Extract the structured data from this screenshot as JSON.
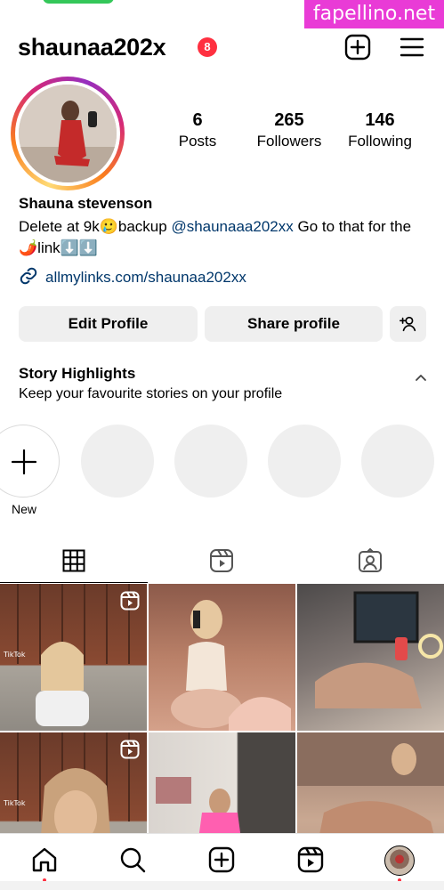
{
  "watermark": "fapellino.net",
  "header": {
    "username": "shaunaa202x",
    "notification_count": "8",
    "icons": [
      "add-post-icon",
      "menu-icon"
    ]
  },
  "profile": {
    "stats": [
      {
        "value": "6",
        "label": "Posts"
      },
      {
        "value": "265",
        "label": "Followers"
      },
      {
        "value": "146",
        "label": "Following"
      }
    ],
    "full_name": "Shauna stevenson",
    "bio": {
      "part1": "Delete at 9k🥲backup ",
      "mention": "@shaunaaa202xx",
      "part2": "      Go to that for the 🌶️link⬇️⬇️"
    },
    "link": "allmylinks.com/shaunaa202xx"
  },
  "actions": {
    "edit_profile": "Edit Profile",
    "share_profile": "Share profile",
    "add_user_icon": "add-user-icon"
  },
  "highlights": {
    "title": "Story Highlights",
    "subtitle": "Keep your favourite stories on your profile",
    "new_label": "New",
    "placeholder_count": 4
  },
  "tabs": [
    "grid-icon",
    "reels-icon",
    "tagged-icon"
  ],
  "grid": {
    "cells": [
      {
        "kind": "reel",
        "watermark": "TikTok"
      },
      {
        "kind": "photo"
      },
      {
        "kind": "photo"
      },
      {
        "kind": "reel",
        "watermark": "TikTok"
      },
      {
        "kind": "photo"
      },
      {
        "kind": "photo"
      }
    ]
  },
  "bottom_nav": [
    "home-icon",
    "search-icon",
    "create-icon",
    "reels-icon",
    "profile-avatar"
  ],
  "colors": {
    "link_blue": "#00376b",
    "badge_red": "#ff3040",
    "button_gray": "#efefef",
    "watermark_pink": "#e93bd6"
  }
}
